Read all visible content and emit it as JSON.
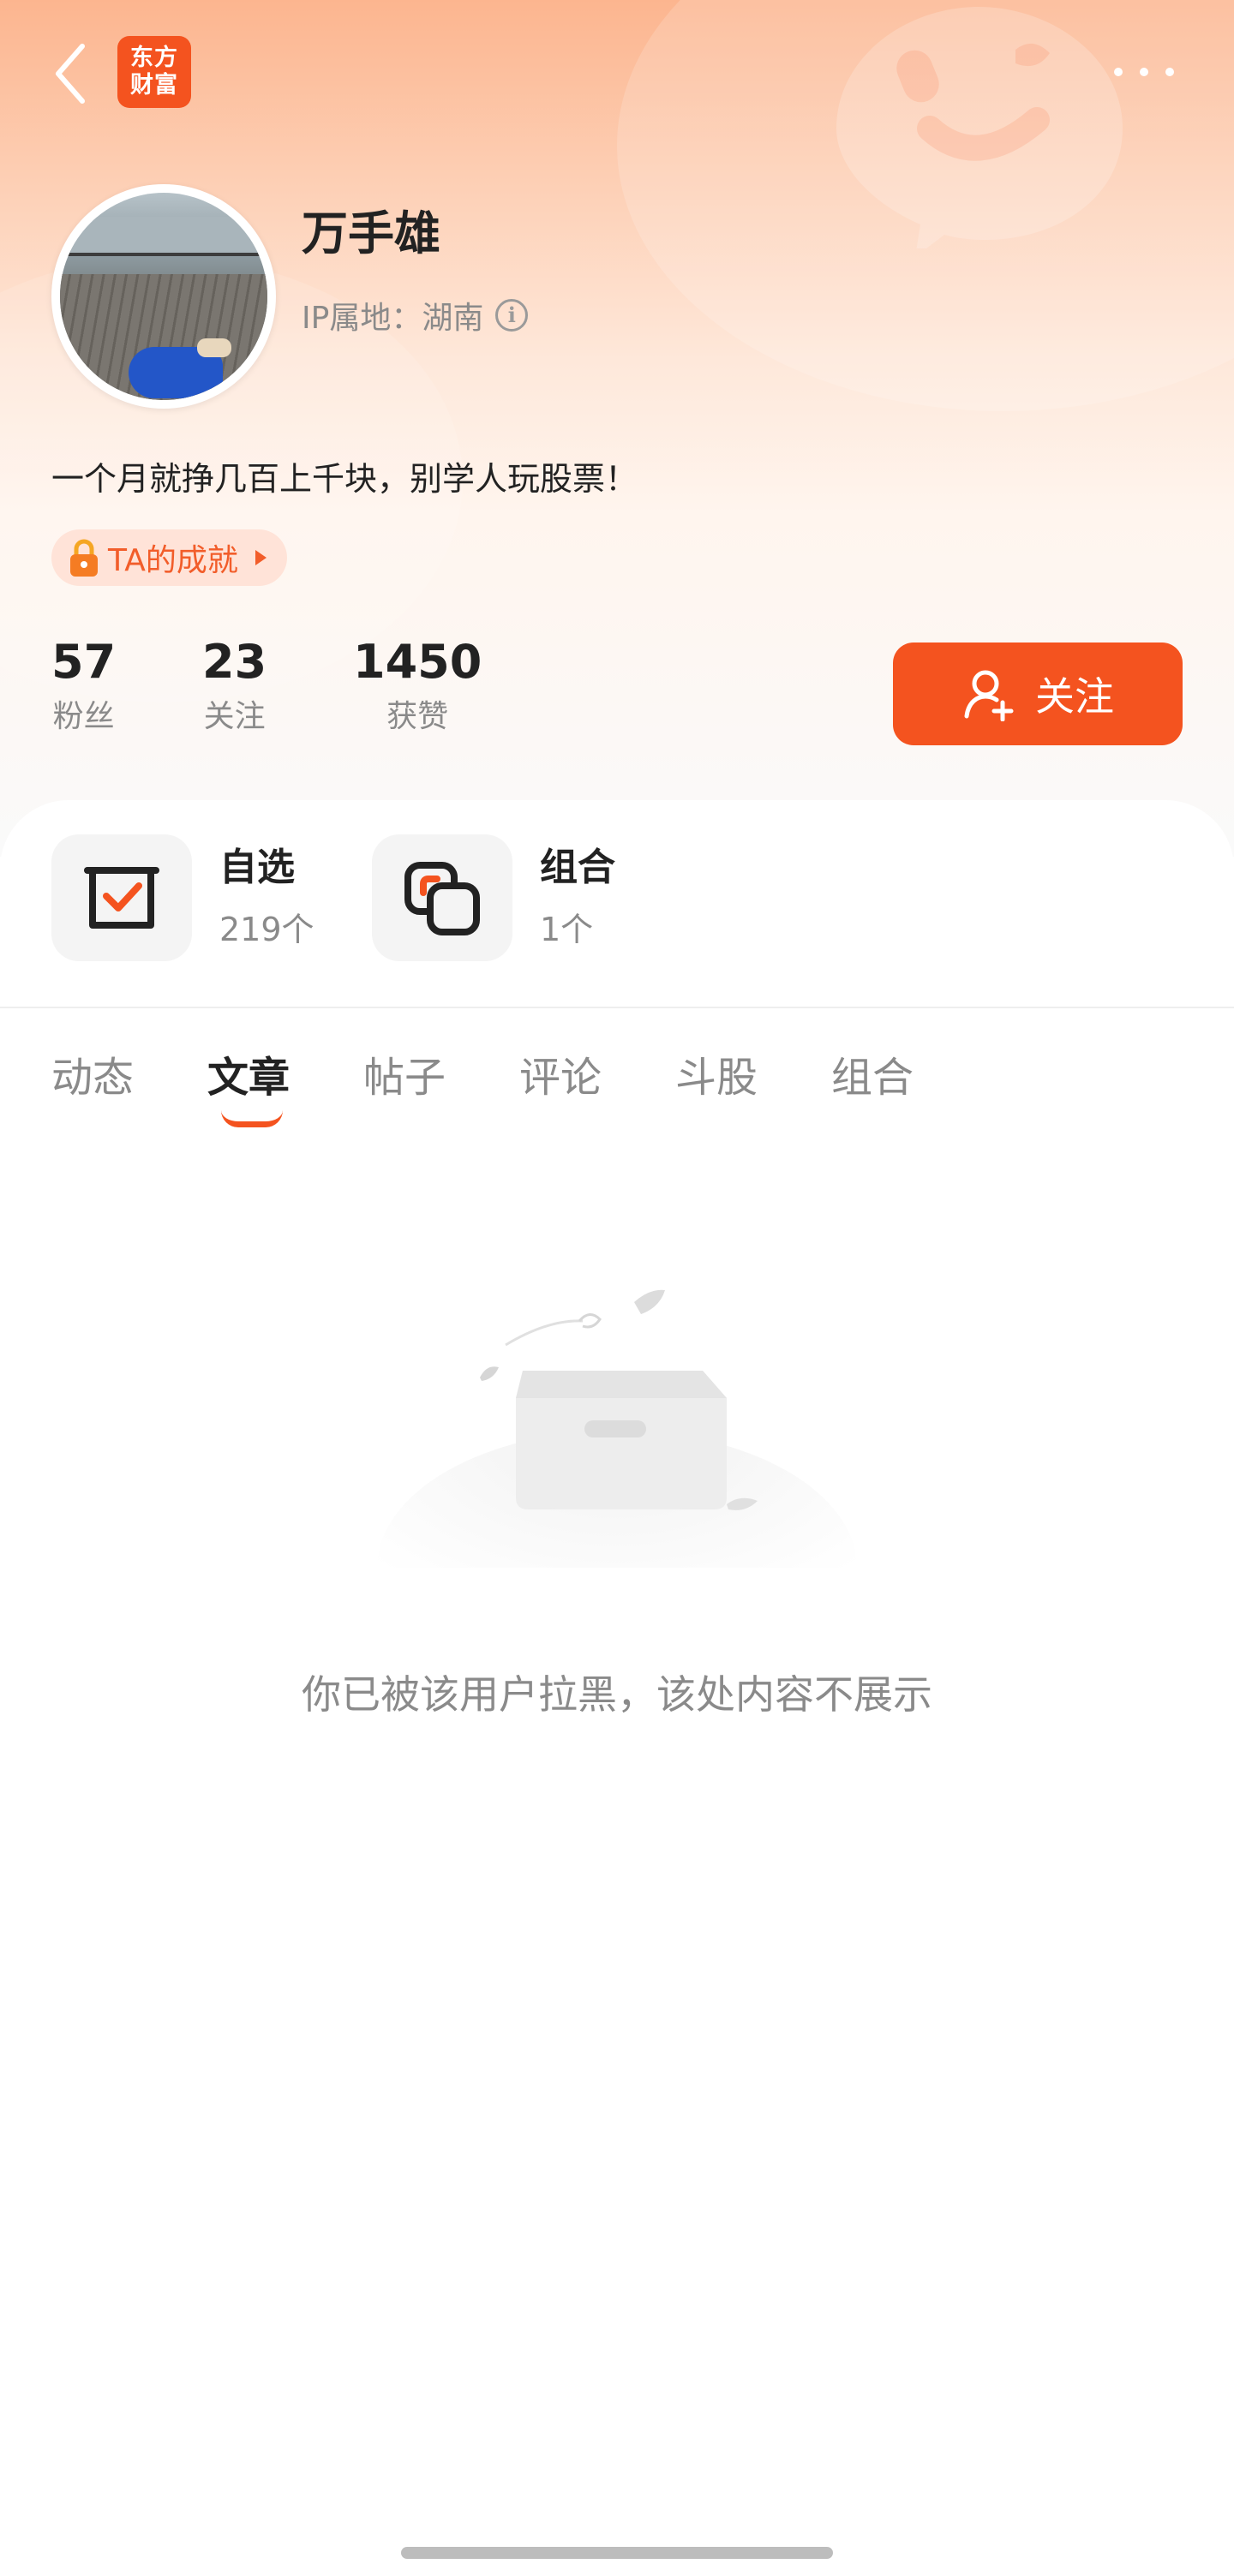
{
  "top_bar": {
    "back_icon": "chevron-left-icon",
    "brand_logo_line1": "东方",
    "brand_logo_line2": "财富",
    "more_icon": "more-dots-icon"
  },
  "profile": {
    "username": "万手雄",
    "ip_location": "IP属地：湖南",
    "info_icon": "info-icon",
    "bio": "一个月就挣几百上千块，别学人玩股票！",
    "achievement_label": "TA的成就"
  },
  "stats": [
    {
      "value": "57",
      "label": "粉丝"
    },
    {
      "value": "23",
      "label": "关注"
    },
    {
      "value": "1450",
      "label": "获赞"
    }
  ],
  "follow_button": {
    "label": "关注",
    "icon": "add-user-icon"
  },
  "shortcuts": [
    {
      "title": "自选",
      "subtitle": "219个",
      "icon": "watchlist-check-icon"
    },
    {
      "title": "组合",
      "subtitle": "1个",
      "icon": "portfolio-icon"
    }
  ],
  "tabs": [
    {
      "label": "动态",
      "active": false
    },
    {
      "label": "文章",
      "active": true
    },
    {
      "label": "帖子",
      "active": false
    },
    {
      "label": "评论",
      "active": false
    },
    {
      "label": "斗股",
      "active": false
    },
    {
      "label": "组合",
      "active": false
    }
  ],
  "empty_state": {
    "message": "你已被该用户拉黑，该处内容不展示",
    "illustration": "empty-box-icon"
  },
  "colors": {
    "accent": "#f4531f",
    "text_primary": "#222222",
    "text_secondary": "#8a8a8a"
  }
}
